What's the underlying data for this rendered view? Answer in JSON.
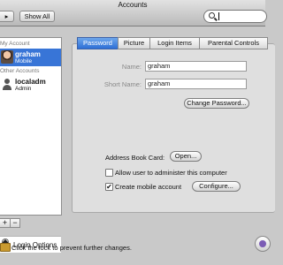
{
  "window": {
    "title": "Accounts"
  },
  "toolbar": {
    "forward_glyph": "▸",
    "show_all_label": "Show All",
    "search_value": ""
  },
  "sidebar": {
    "my_account_header": "My Account",
    "other_accounts_header": "Other Accounts",
    "accounts": [
      {
        "name": "graham",
        "role": "Mobile",
        "selected": true
      },
      {
        "name": "localadm",
        "role": "Admin",
        "selected": false
      }
    ],
    "login_options_label": "Login Options",
    "add_glyph": "+",
    "remove_glyph": "−"
  },
  "tabs": [
    {
      "label": "Password",
      "active": true
    },
    {
      "label": "Picture",
      "active": false
    },
    {
      "label": "Login Items",
      "active": false
    },
    {
      "label": "Parental Controls",
      "active": false
    }
  ],
  "password_pane": {
    "name_label": "Name:",
    "name_value": "graham",
    "short_name_label": "Short Name:",
    "short_name_value": "graham",
    "change_password_label": "Change Password...",
    "address_book_label": "Address Book Card:",
    "open_label": "Open...",
    "allow_admin_label": "Allow user to administer this computer",
    "allow_admin_checked": false,
    "mobile_account_label": "Create mobile account",
    "mobile_account_checked": true,
    "checkmark": "✔",
    "configure_label": "Configure..."
  },
  "footer": {
    "lock_text": "Click the lock to prevent further changes."
  },
  "colors": {
    "selection": "#3875d7",
    "active_tab": "#2e6fd6",
    "pane_bg": "#dfdfdf"
  },
  "icons": [
    "search-icon",
    "house-icon",
    "lock-icon",
    "help-icon",
    "user-photo-icon",
    "user-silhouette-icon"
  ]
}
